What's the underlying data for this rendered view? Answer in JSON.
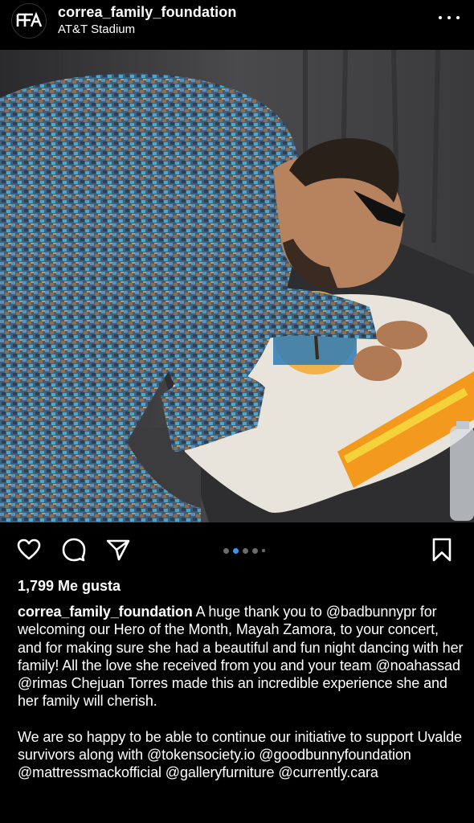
{
  "post": {
    "username": "correa_family_foundation",
    "location": "AT&T Stadium",
    "likes": "1,799 Me gusta",
    "carousel": {
      "total_dots": 5,
      "active_index": 1
    },
    "caption": {
      "author": "correa_family_foundation",
      "paragraph1": "A huge thank you to @badbunnypr for welcoming our Hero of the Month, Mayah Zamora, to your concert, and for making sure she had a beautiful and fun night dancing with her family! All the love she received from you and your team @noahassad @rimas Chejuan Torres made this an incredible experience she and her family will cherish.",
      "paragraph2": "We are so happy to be able to continue our initiative to support Uvalde survivors along with @tokensociety.io @goodbunnyfoundation @mattressmackofficial @galleryfurniture @currently.cara"
    }
  },
  "icons": {
    "avatar": "cff-logo",
    "more": "more-options-icon",
    "like": "heart-icon",
    "comment": "comment-icon",
    "share": "paper-plane-icon",
    "save": "bookmark-icon"
  },
  "colors": {
    "background": "#000000",
    "text": "#ffffff",
    "carousel_active": "#3897f0",
    "carousel_inactive": "#6b6b6b"
  }
}
